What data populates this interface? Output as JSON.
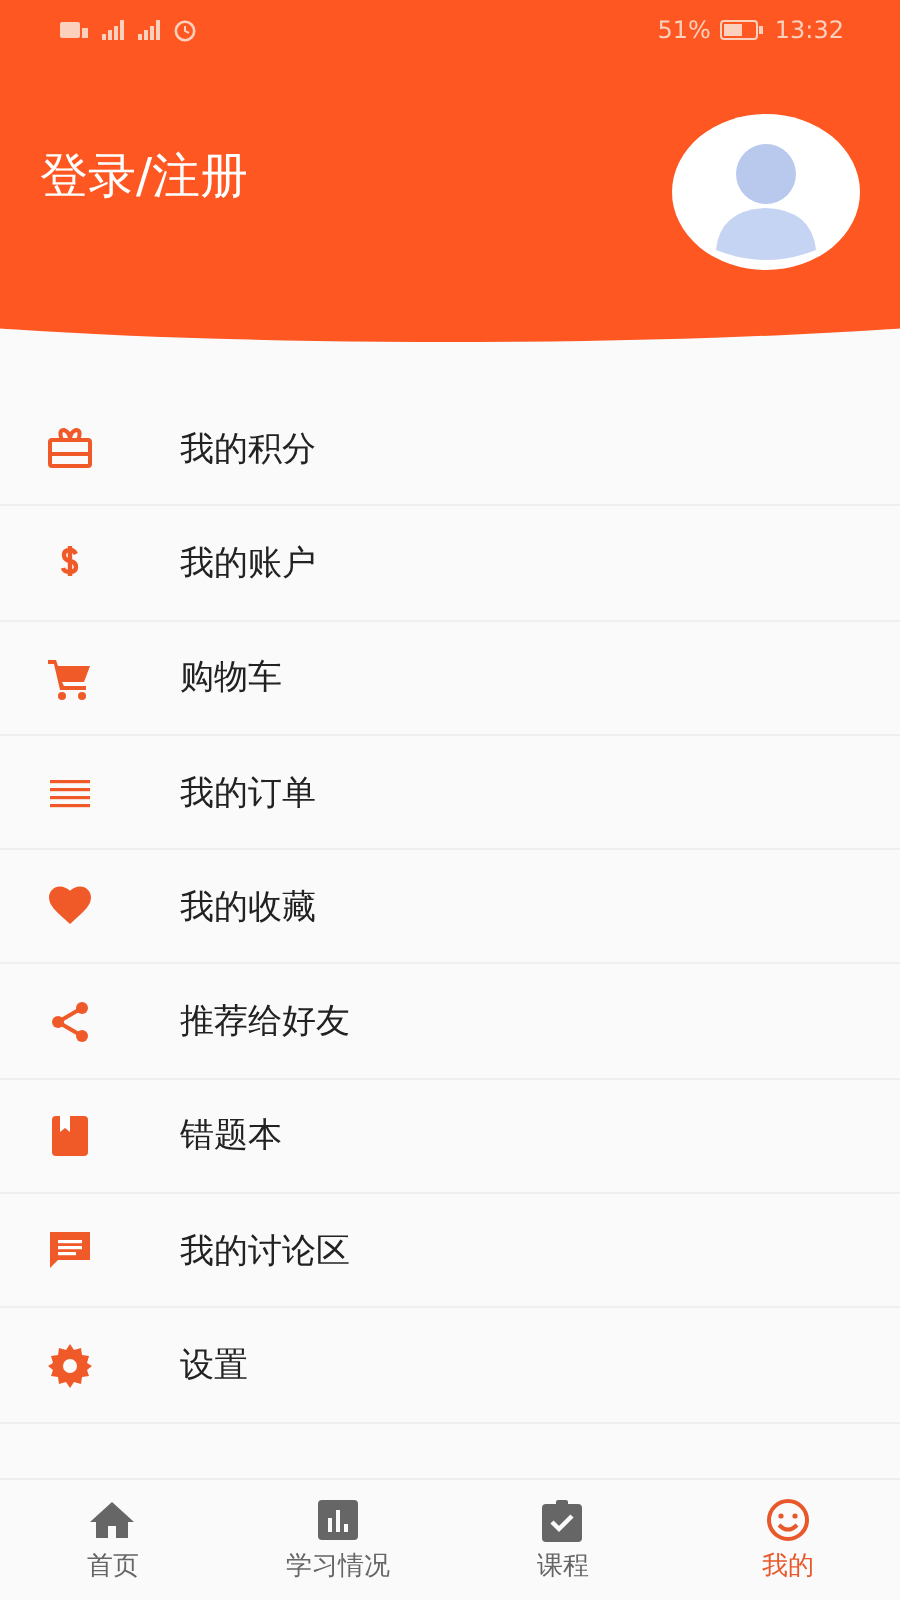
{
  "status_bar": {
    "battery": "51%",
    "time": "13:32"
  },
  "header": {
    "title": "登录/注册"
  },
  "menu": [
    {
      "kind": "gift",
      "label": "我的积分"
    },
    {
      "kind": "dollar",
      "label": "我的账户"
    },
    {
      "kind": "cart",
      "label": "购物车"
    },
    {
      "kind": "list",
      "label": "我的订单"
    },
    {
      "kind": "heart",
      "label": "我的收藏"
    },
    {
      "kind": "share",
      "label": "推荐给好友"
    },
    {
      "kind": "book",
      "label": "错题本"
    },
    {
      "kind": "comment",
      "label": "我的讨论区"
    },
    {
      "kind": "gear",
      "label": "设置"
    }
  ],
  "tabs": [
    {
      "kind": "home",
      "label": "首页",
      "selected": false
    },
    {
      "kind": "chart",
      "label": "学习情况",
      "selected": false
    },
    {
      "kind": "clipboard",
      "label": "课程",
      "selected": false
    },
    {
      "kind": "smile",
      "label": "我的",
      "selected": true
    }
  ]
}
